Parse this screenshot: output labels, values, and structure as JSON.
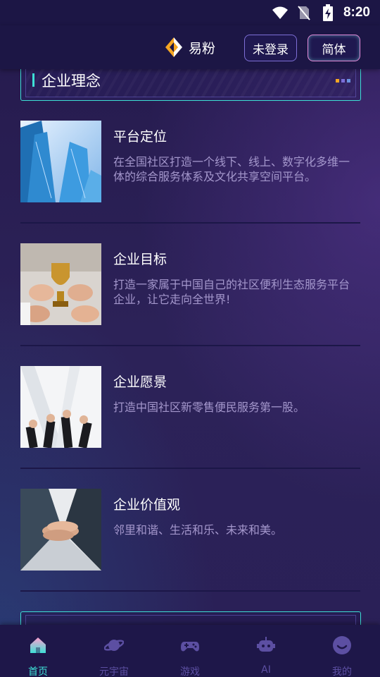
{
  "status": {
    "time": "8:20",
    "icons": [
      "wifi-icon",
      "no-sim-icon",
      "battery-charging-icon"
    ]
  },
  "header": {
    "brand_name": "易粉",
    "brand_icon": "yifen-logo-icon",
    "login_label": "未登录",
    "lang_label": "简体"
  },
  "section": {
    "title": "企业理念",
    "accent": "#3ee0d6"
  },
  "items": [
    {
      "title": "平台定位",
      "desc": "在全国社区打造一个线下、线上、数字化多维一体的综合服务体系及文化共享空间平台。",
      "image": "skyscrapers-photo"
    },
    {
      "title": "企业目标",
      "desc": "打造一家属于中国自己的社区便利生态服务平台企业，让它走向全世界!",
      "image": "trophy-hands-photo"
    },
    {
      "title": "企业愿景",
      "desc": "打造中国社区新零售便民服务第一股。",
      "image": "raised-fists-photo"
    },
    {
      "title": "企业价值观",
      "desc": "邻里和谐、生活和乐、未来和美。",
      "image": "stacked-hands-photo"
    }
  ],
  "nav": [
    {
      "label": "首页",
      "icon": "home-icon",
      "active": true
    },
    {
      "label": "元宇宙",
      "icon": "planet-icon",
      "active": false
    },
    {
      "label": "游戏",
      "icon": "gamepad-icon",
      "active": false
    },
    {
      "label": "AI",
      "icon": "robot-icon",
      "active": false
    },
    {
      "label": "我的",
      "icon": "smiley-icon",
      "active": false
    }
  ],
  "colors": {
    "background": "#2a1f52",
    "bar": "#1c1645",
    "accent": "#3ee0d6",
    "muted_text": "#a497cc",
    "nav_inactive": "#5c4fa2"
  }
}
